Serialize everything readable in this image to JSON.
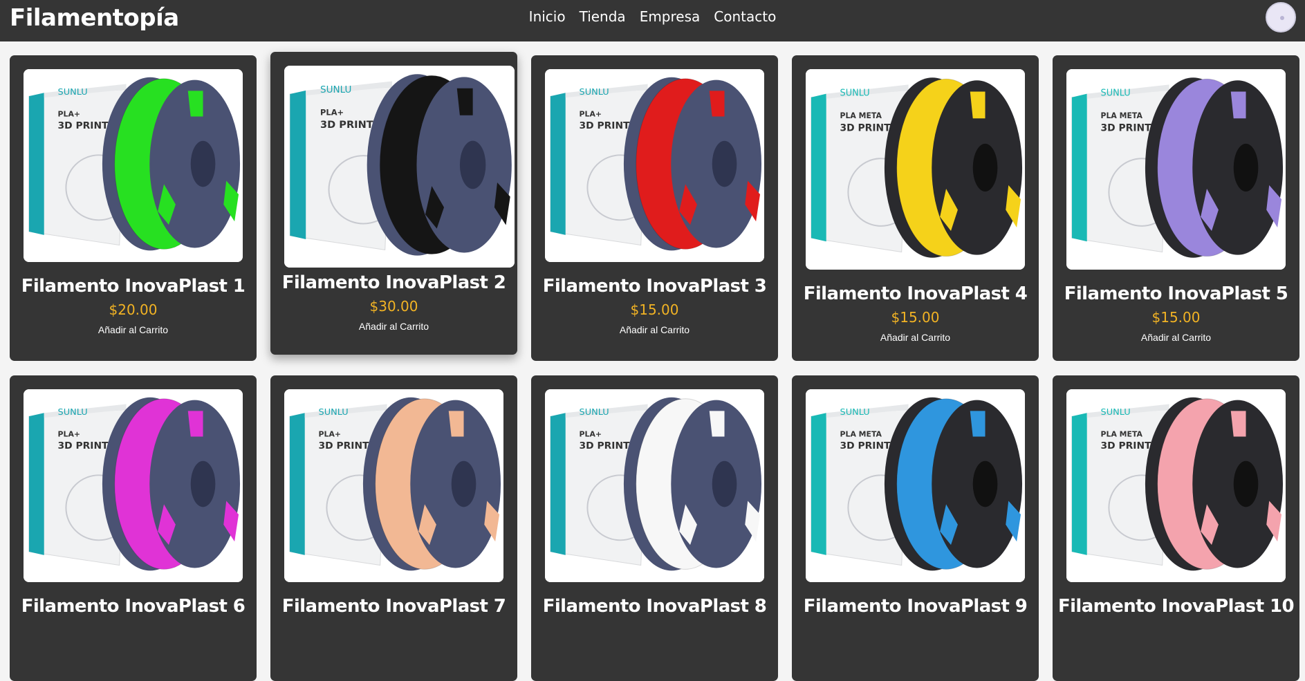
{
  "header": {
    "brand": "Filamentopía",
    "nav": [
      "Inicio",
      "Tienda",
      "Empresa",
      "Contacto"
    ]
  },
  "products": [
    {
      "title": "Filamento InovaPlast 1",
      "price": "$20.00",
      "cta": "Añadir al Carrito",
      "color": "#27e021",
      "box_label": "PLA+",
      "box_title": "3D PRINTING",
      "box_brand": "SUNLU",
      "spool": "blue"
    },
    {
      "title": "Filamento InovaPlast 2",
      "price": "$30.00",
      "cta": "Añadir al Carrito",
      "color": "#151515",
      "box_label": "PLA+",
      "box_title": "3D PRINTING",
      "box_brand": "SUNLU",
      "spool": "blue"
    },
    {
      "title": "Filamento InovaPlast 3",
      "price": "$15.00",
      "cta": "Añadir al Carrito",
      "color": "#e01c1c",
      "box_label": "PLA+",
      "box_title": "3D PRINTING",
      "box_brand": "SUNLU",
      "spool": "blue"
    },
    {
      "title": "Filamento InovaPlast 4",
      "price": "$15.00",
      "cta": "Añadir al Carrito",
      "color": "#f5d21a",
      "box_label": "PLA META",
      "box_title": "3D PRINTING",
      "box_brand": "SUNLU",
      "spool": "black"
    },
    {
      "title": "Filamento InovaPlast 5",
      "price": "$15.00",
      "cta": "Añadir al Carrito",
      "color": "#9a86dc",
      "box_label": "PLA META",
      "box_title": "3D PRINTING",
      "box_brand": "SUNLU",
      "spool": "black"
    },
    {
      "title": "Filamento InovaPlast 6",
      "price": "",
      "cta": "",
      "color": "#e033d6",
      "box_label": "PLA+",
      "box_title": "3D PRINTING",
      "box_brand": "SUNLU",
      "spool": "blue"
    },
    {
      "title": "Filamento InovaPlast 7",
      "price": "",
      "cta": "",
      "color": "#f2b894",
      "box_label": "PLA+",
      "box_title": "3D PRINTING",
      "box_brand": "SUNLU",
      "spool": "blue"
    },
    {
      "title": "Filamento InovaPlast 8",
      "price": "",
      "cta": "",
      "color": "#f7f7f7",
      "box_label": "PLA+",
      "box_title": "3D PRINTING",
      "box_brand": "SUNLU",
      "spool": "blue"
    },
    {
      "title": "Filamento InovaPlast 9",
      "price": "",
      "cta": "",
      "color": "#2f96de",
      "box_label": "PLA META",
      "box_title": "3D PRINTING",
      "box_brand": "SUNLU",
      "spool": "black"
    },
    {
      "title": "Filamento InovaPlast 10",
      "price": "",
      "cta": "",
      "color": "#f4a3ad",
      "box_label": "PLA META",
      "box_title": "3D PRINTING",
      "box_brand": "SUNLU",
      "spool": "black"
    }
  ]
}
